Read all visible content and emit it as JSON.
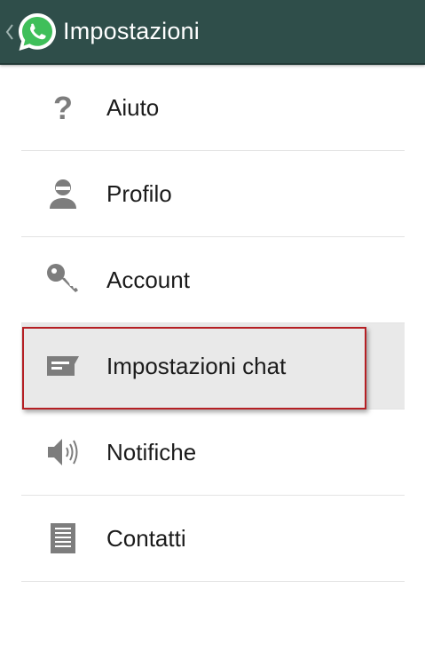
{
  "header": {
    "title": "Impostazioni",
    "bar_color": "#2f4e4a",
    "logo_icon": "whatsapp-logo-icon",
    "back_icon": "chevron-left-icon"
  },
  "menu": {
    "items": [
      {
        "label": "Aiuto",
        "icon": "help-icon",
        "selected": false
      },
      {
        "label": "Profilo",
        "icon": "profile-icon",
        "selected": false
      },
      {
        "label": "Account",
        "icon": "key-icon",
        "selected": false
      },
      {
        "label": "Impostazioni chat",
        "icon": "chat-settings-icon",
        "selected": true
      },
      {
        "label": "Notifiche",
        "icon": "speaker-icon",
        "selected": false
      },
      {
        "label": "Contatti",
        "icon": "contacts-icon",
        "selected": false
      }
    ]
  },
  "highlight_color": "#b51f24"
}
